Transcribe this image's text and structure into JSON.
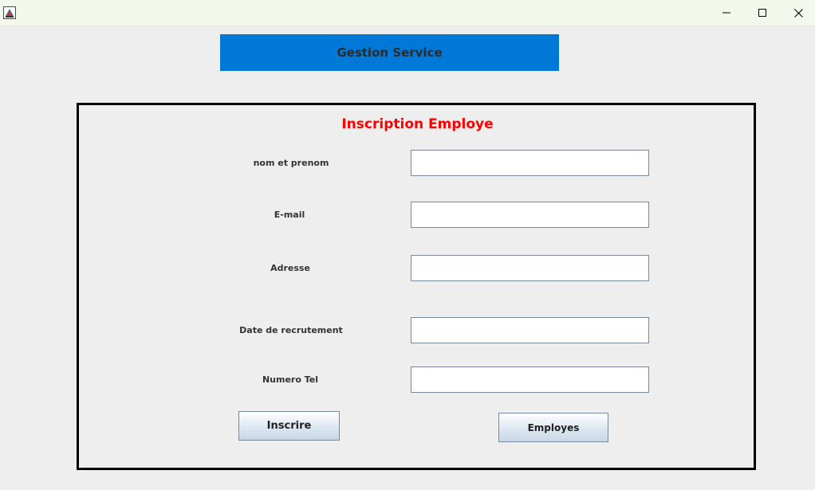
{
  "window": {
    "icon": "java-app-icon",
    "controls": {
      "minimize_icon": "minimize-icon",
      "maximize_icon": "maximize-icon",
      "close_icon": "close-icon"
    }
  },
  "header": {
    "title": "Gestion Service",
    "background_color": "#0078d7"
  },
  "form": {
    "title": "Inscription Employe",
    "title_color": "#ff0000",
    "fields": [
      {
        "label": "nom et prenom",
        "value": ""
      },
      {
        "label": "E-mail",
        "value": ""
      },
      {
        "label": "Adresse",
        "value": ""
      },
      {
        "label": "Date de recrutement",
        "value": ""
      },
      {
        "label": "Numero Tel",
        "value": ""
      }
    ],
    "buttons": {
      "submit": "Inscrire",
      "list": "Employes"
    }
  }
}
